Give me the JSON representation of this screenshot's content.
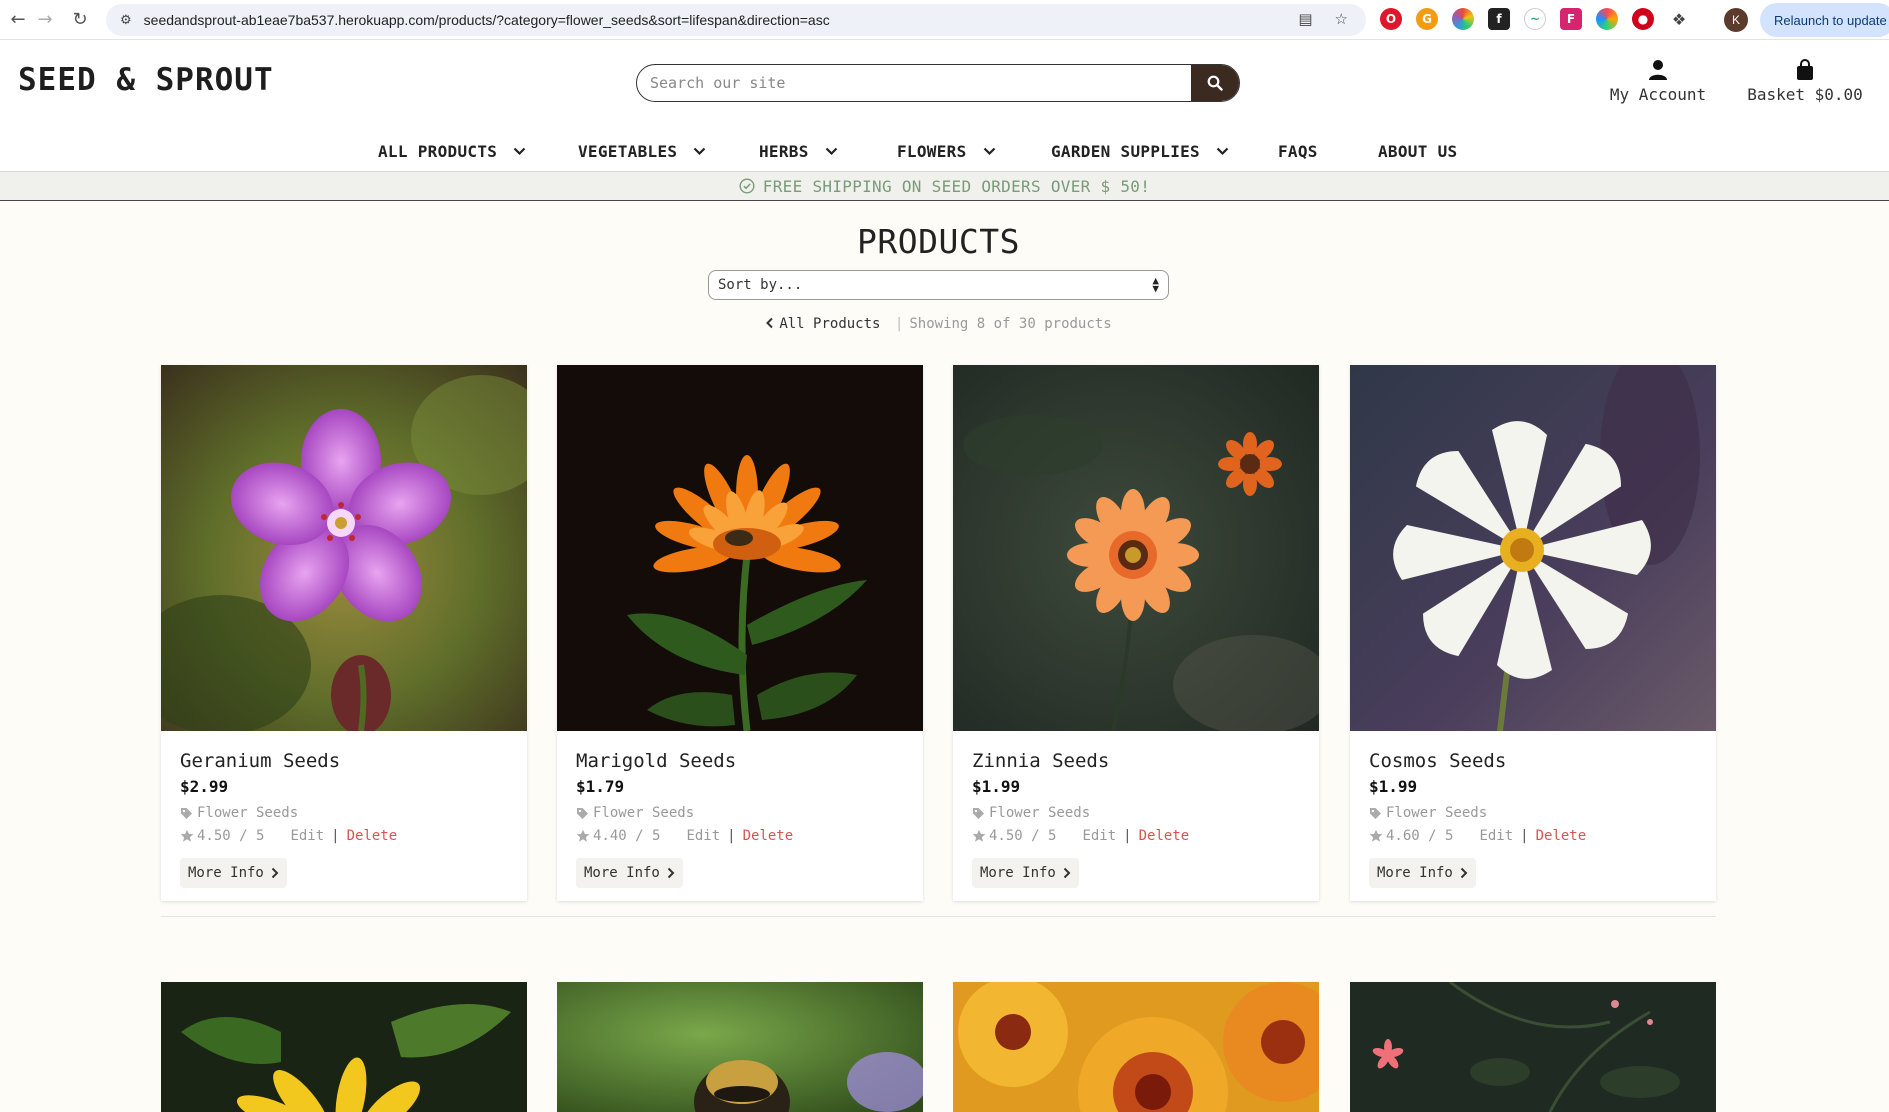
{
  "browser": {
    "url": "seedandsprout-ab1eae7ba537.herokuapp.com/products/?category=flower_seeds&sort=lifespan&direction=asc",
    "relaunch_label": "Relaunch to update",
    "profile_initial": "K"
  },
  "header": {
    "logo": "SEED & SPROUT",
    "search_placeholder": "Search our site",
    "account_label": "My Account",
    "basket_label": "Basket $0.00"
  },
  "nav": {
    "items": [
      "ALL PRODUCTS",
      "VEGETABLES",
      "HERBS",
      "FLOWERS",
      "GARDEN SUPPLIES",
      "FAQS",
      "ABOUT US"
    ]
  },
  "banner": {
    "text": "FREE SHIPPING ON SEED ORDERS OVER $ 50!"
  },
  "products_page": {
    "title": "PRODUCTS",
    "sort_label": "Sort by...",
    "all_products_link": "All Products",
    "showing_text": "Showing 8 of 30 products"
  },
  "products": [
    {
      "name": "Geranium Seeds",
      "price": "$2.99",
      "category": "Flower Seeds",
      "rating": "4.50 / 5",
      "edit": "Edit",
      "delete": "Delete",
      "more": "More Info"
    },
    {
      "name": "Marigold Seeds",
      "price": "$1.79",
      "category": "Flower Seeds",
      "rating": "4.40 / 5",
      "edit": "Edit",
      "delete": "Delete",
      "more": "More Info"
    },
    {
      "name": "Zinnia Seeds",
      "price": "$1.99",
      "category": "Flower Seeds",
      "rating": "4.50 / 5",
      "edit": "Edit",
      "delete": "Delete",
      "more": "More Info"
    },
    {
      "name": "Cosmos Seeds",
      "price": "$1.99",
      "category": "Flower Seeds",
      "rating": "4.60 / 5",
      "edit": "Edit",
      "delete": "Delete",
      "more": "More Info"
    }
  ],
  "colors": {
    "accent": "#3b2a20",
    "delete": "#d9534f",
    "banner_text": "#7a9a7a",
    "page_bg": "#fdfcf7"
  }
}
